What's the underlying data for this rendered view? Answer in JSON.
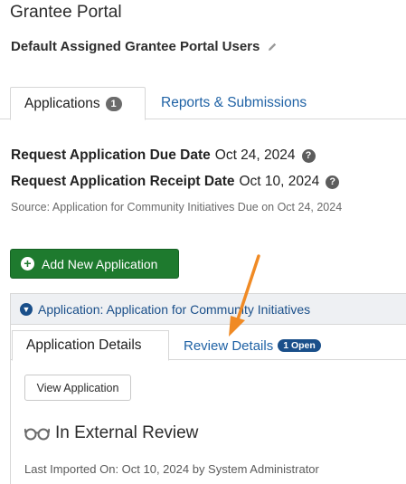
{
  "page": {
    "title": "Grantee Portal"
  },
  "portal_users": {
    "label": "Default Assigned Grantee Portal Users",
    "edit_icon": "pencil-icon"
  },
  "tabs": [
    {
      "label": "Applications",
      "count": "1",
      "active": true
    },
    {
      "label": "Reports & Submissions",
      "active": false
    }
  ],
  "dates": {
    "due_label": "Request Application Due Date",
    "due_value": "Oct 24, 2024",
    "receipt_label": "Request Application Receipt Date",
    "receipt_value": "Oct 10, 2024",
    "help_glyph": "?",
    "source": "Source: Application for Community Initiatives Due on Oct 24, 2024"
  },
  "add_button": {
    "label": "Add New Application",
    "icon": "plus-circle-icon"
  },
  "application_panel": {
    "header": "Application: Application for Community Initiatives",
    "tabs": [
      {
        "label": "Application Details",
        "active": true
      },
      {
        "label": "Review Details",
        "badge": "1 Open",
        "active": false
      }
    ],
    "view_button": "View Application",
    "status": "In External Review",
    "status_icon": "glasses-icon",
    "imported": "Last Imported On: Oct 10, 2024 by System Administrator"
  },
  "colors": {
    "accent_green": "#1e7a2e",
    "link_blue": "#1f62a5",
    "annotation_arrow": "#f08a24"
  }
}
